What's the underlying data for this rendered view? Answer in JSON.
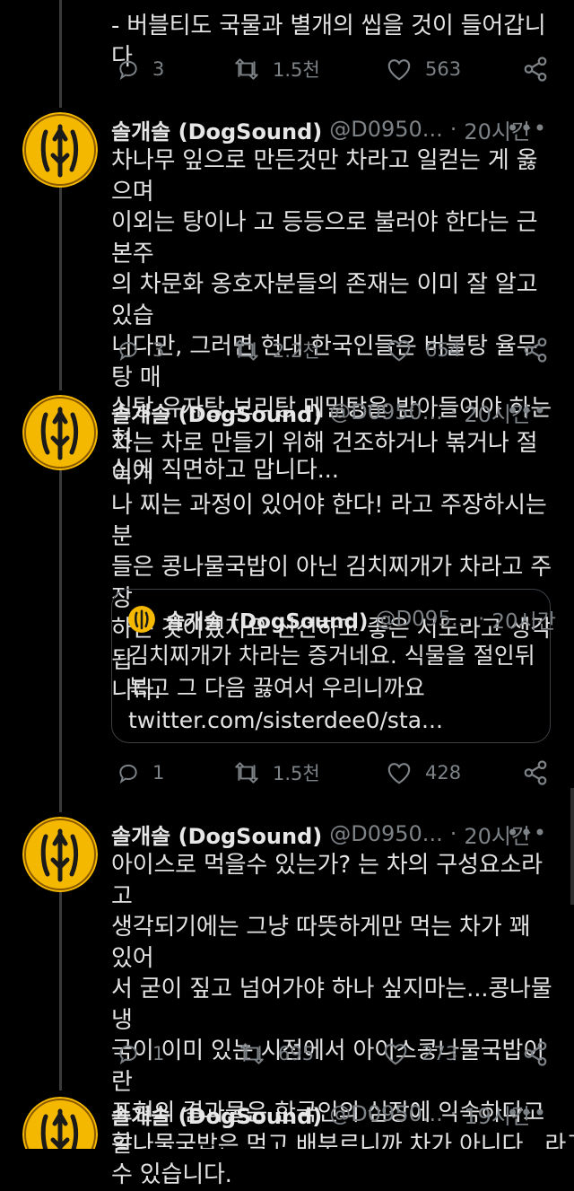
{
  "top_tweet": {
    "partial_line": "- 버블티도 국물과 별개의 씹을 것이 들어갑니다",
    "replies": "3",
    "retweets": "1.5천",
    "likes": "563"
  },
  "tweets": [
    {
      "name": "솔개솔 (DogSound)",
      "handle": "@D0950...",
      "time": "20시간",
      "text": "차나무 잎으로 만든것만 차라고 일컫는 게 옳으며\n이외는 탕이나 고 등등으로 불러야 한다는 근본주\n의 차문화 옹호자분들의 존재는 이미 잘 알고 있습\n니다만, 그러면 현대 한국인들은 버블탕 율무탕 매\n실탕 유자탕 보리탕 메밀탕을 받아들여야 하는 현\n실에 직면하고 맙니다...",
      "replies": "3",
      "retweets": "2.2천",
      "likes": "654"
    },
    {
      "name": "솔개솔 (DogSound)",
      "handle": "@D0950...",
      "time": "20시간",
      "text": "차는 차로 만들기 위해 건조하거나 볶거나 절이거\n나 찌는 과정이 있어야 한다! 라고 주장하시는 분\n들은 콩나물국밥이 아닌 김치찌개가 차라고 주장\n하는 것이겠지요 신선하고 좋은 시도라고 생각됩\n니다.",
      "quote": {
        "name": "솔개솔 (DogSound)",
        "handle": "@D095...",
        "time": "20시간",
        "text": "김치찌개가 차라는 증거네요. 식물을 절인뒤\n볶고 그 다음 끓여서 우리니까요\ntwitter.com/sisterdee0/sta..."
      },
      "replies": "1",
      "retweets": "1.5천",
      "likes": "428"
    },
    {
      "name": "솔개솔 (DogSound)",
      "handle": "@D0950...",
      "time": "20시간",
      "text": "아이스로 먹을수 있는가? 는 차의 구성요소라고\n생각되기에는 그냥 따뜻하게만 먹는 차가 꽤 있어\n서 굳이 짚고 넘어가야 하나 싶지마는...콩나물냉\n국이 이미 있는 시점에서 아이스콩나물국밥이란\n표현의 결과물은 한국인의 심장에 익숙하다고 할\n수 있습니다.",
      "replies": "1",
      "retweets": "695",
      "likes": "273"
    },
    {
      "name": "솔개솔 (DogSound)",
      "handle": "@D0950...",
      "time": "19시간",
      "text": "콩나물국밥은 먹고 배부르니까 차가 아니다...라고"
    }
  ],
  "dot": "·",
  "more": "•••",
  "colors": {
    "background": "#000000",
    "text": "#e3e3e3",
    "muted": "#7d8287",
    "avatar_yellow": "#f5b800"
  },
  "icons": [
    "reply-icon",
    "retweet-icon",
    "like-icon",
    "share-icon",
    "more-icon"
  ]
}
